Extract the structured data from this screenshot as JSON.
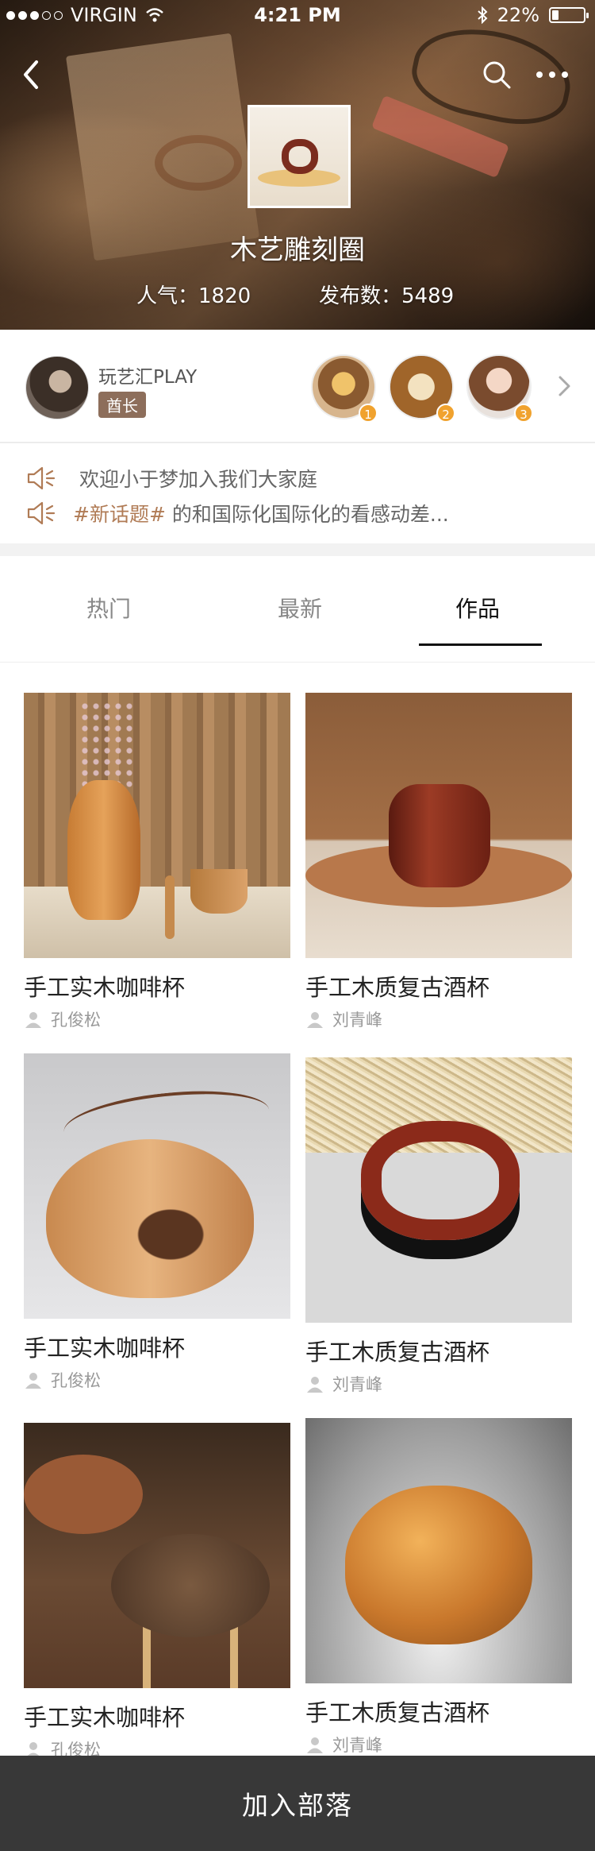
{
  "status_bar": {
    "carrier": "VIRGIN",
    "time": "4:21 PM",
    "battery": "22%",
    "battery_level": 0.22
  },
  "header": {
    "title": "木艺雕刻圈",
    "popularity": "人气：1820",
    "posts": "发布数：5489"
  },
  "owner": {
    "name": "玩艺汇PLAY",
    "badge": "酋长"
  },
  "top_members": [
    {
      "rank": "1"
    },
    {
      "rank": "2"
    },
    {
      "rank": "3"
    }
  ],
  "notices": [
    {
      "topic": "",
      "text": "欢迎小于梦加入我们大家庭"
    },
    {
      "topic": "#新话题#",
      "text": "的和国际化国际化的看感动差..."
    }
  ],
  "tabs": [
    {
      "label": "热门"
    },
    {
      "label": "最新"
    },
    {
      "label": "作品"
    }
  ],
  "active_tab": "作品",
  "products": [
    {
      "title": "手工实木咖啡杯",
      "author": "孔俊松"
    },
    {
      "title": "手工木质复古酒杯",
      "author": "刘青峰"
    },
    {
      "title": "手工实木咖啡杯",
      "author": "孔俊松"
    },
    {
      "title": "手工木质复古酒杯",
      "author": "刘青峰"
    },
    {
      "title": "手工实木咖啡杯",
      "author": "孔俊松"
    },
    {
      "title": "手工木质复古酒杯",
      "author": "刘青峰"
    }
  ],
  "join_button": "加入部落",
  "colors": {
    "accent": "#b07b55",
    "badge": "#8d6e5b",
    "rank_medal": "#f0a22e",
    "bottom_bar": "#383838"
  },
  "icons": {
    "back": "chevron-left-icon",
    "search": "search-icon",
    "more": "more-dots-icon",
    "notice": "speaker-icon",
    "author": "user-icon",
    "next": "chevron-right-icon"
  }
}
